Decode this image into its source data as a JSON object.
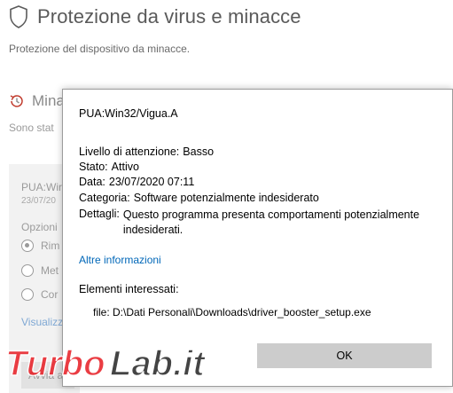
{
  "background": {
    "title": "Protezione da virus e minacce",
    "subtitle": "Protezione del dispositivo da minacce.",
    "section_title": "Mina",
    "section_subtitle": "Sono stat",
    "card": {
      "threat_name": "PUA:Wir",
      "date": "23/07/20",
      "options_label": "Opzioni",
      "radio_options": [
        "Rim",
        "Met",
        "Cor"
      ],
      "link": "Visualizz",
      "apply_button": "Avvia a"
    }
  },
  "dialog": {
    "title": "PUA:Win32/Vigua.A",
    "fields": {
      "level_label": "Livello di attenzione:",
      "level_value": "Basso",
      "status_label": "Stato:",
      "status_value": "Attivo",
      "date_label": "Data:",
      "date_value": "23/07/2020 07:11",
      "category_label": "Categoria:",
      "category_value": "Software potenzialmente indesiderato",
      "details_label": "Dettagli:",
      "details_value": "Questo programma presenta comportamenti potenzialmente indesiderati."
    },
    "more_info_link": "Altre informazioni",
    "affected_label": "Elementi interessati:",
    "affected_file": "file: D:\\Dati Personali\\Downloads\\driver_booster_setup.exe",
    "ok_button": "OK"
  },
  "watermark": {
    "text_part1": "Turbo",
    "text_part2": "Lab.it"
  },
  "colors": {
    "link": "#0067b8",
    "ok_button_bg": "#cccccc",
    "watermark_red": "#e8232a"
  }
}
